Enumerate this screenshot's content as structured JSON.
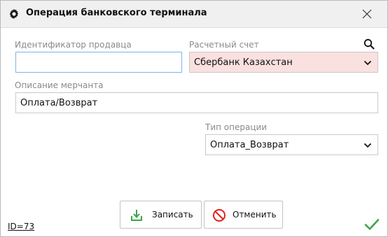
{
  "dialog": {
    "title": "Операция банковского терминала",
    "title_icon": "gear-icon",
    "close_icon": "close-icon"
  },
  "form": {
    "seller_id": {
      "label": "Идентификатор продавца",
      "value": ""
    },
    "account": {
      "label": "Расчетный счет",
      "value": "Сбербанк Казахстан",
      "search_icon": "search-icon"
    },
    "merchant_description": {
      "label": "Описание мерчанта",
      "value": "Оплата/Возврат"
    },
    "operation_type": {
      "label": "Тип операции",
      "value": "Оплата_Возврат"
    }
  },
  "buttons": {
    "save_label": "Записать",
    "save_icon": "download-icon",
    "cancel_label": "Отменить",
    "cancel_icon": "prohibited-icon"
  },
  "footer": {
    "id_text": "ID=73",
    "ok_icon": "checkmark-icon"
  },
  "colors": {
    "account_field_bg": "#fbe0e0",
    "save_icon_color": "#3aa64a",
    "cancel_icon_color": "#e2231a",
    "checkmark_color": "#3aa64a"
  }
}
